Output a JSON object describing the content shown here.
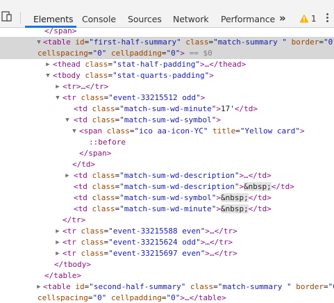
{
  "toolbar": {
    "tabs": [
      {
        "label": "Elements",
        "active": true
      },
      {
        "label": "Console"
      },
      {
        "label": "Sources"
      },
      {
        "label": "Network"
      },
      {
        "label": "Performance"
      }
    ],
    "more_label": "»",
    "warning_count": "1",
    "colors": {
      "active_underline": "#1a73e8",
      "warning": "#f5b400"
    }
  },
  "tree": {
    "l01": "</span>",
    "l02_tag": "<table",
    "l02_a1": "id",
    "l02_v1": "\"first-half-summary\"",
    "l02_a2": "class",
    "l02_v2": "\"match-summary \"",
    "l02_a3": "border",
    "l02_v3": "\"0\"",
    "l03_a1": "cellspacing",
    "l03_v1": "\"0\"",
    "l03_a2": "cellpadding",
    "l03_v2": "\"0\"",
    "l03_tail": ">",
    "l03_eq": " == $0",
    "l04": {
      "open": "<thead",
      "attr": "class",
      "val": "\"stat-half-padding\"",
      "mid": ">…",
      "close": "</thead>"
    },
    "l05": {
      "open": "<tbody",
      "attr": "class",
      "val": "\"stat-quarts-padding\"",
      "mid": ">"
    },
    "l06": {
      "open": "<tr>",
      "mid": "…",
      "close": "</tr>"
    },
    "l07": {
      "open": "<tr",
      "attr": "class",
      "val": "\"event-33215512 odd\"",
      "mid": ">"
    },
    "l08": {
      "open": "<td",
      "attr": "class",
      "val": "\"match-sum-wd-minute\"",
      "mid": ">",
      "text": "17'",
      "close": "</td>"
    },
    "l09": {
      "open": "<td",
      "attr": "class",
      "val": "\"match-sum-wd-symbol\"",
      "mid": ">"
    },
    "l10": {
      "open": "<span",
      "attr": "class",
      "val": "\"ico aa-icon-YC\"",
      "attr2": "title",
      "val2": "\"Yellow card\"",
      "mid": ">"
    },
    "l11": "::before",
    "l12": "</span>",
    "l13": "</td>",
    "l14": {
      "open": "<td",
      "attr": "class",
      "val": "\"match-sum-wd-description\"",
      "mid": ">…",
      "close": "</td>"
    },
    "l15": {
      "open": "<td",
      "attr": "class",
      "val": "\"match-sum-wd-description\"",
      "mid": ">",
      "ent": "&nbsp;",
      "close": "</td>"
    },
    "l16": {
      "open": "<td",
      "attr": "class",
      "val": "\"match-sum-wd-symbol\"",
      "mid": ">",
      "ent": "&nbsp;",
      "close": "</td>"
    },
    "l17": {
      "open": "<td",
      "attr": "class",
      "val": "\"match-sum-wd-minute\"",
      "mid": ">",
      "ent": "&nbsp;",
      "close": "</td>"
    },
    "l18": "</tr>",
    "l19": {
      "open": "<tr",
      "attr": "class",
      "val": "\"event-33215588 even\"",
      "mid": ">…",
      "close": "</tr>"
    },
    "l20": {
      "open": "<tr",
      "attr": "class",
      "val": "\"event-33215624 odd\"",
      "mid": ">…",
      "close": "</tr>"
    },
    "l21": {
      "open": "<tr",
      "attr": "class",
      "val": "\"event-33215697 even\"",
      "mid": ">…",
      "close": "</tr>"
    },
    "l22": "</tbody>",
    "l23": "</table>",
    "l24_tag": "<table",
    "l24_a1": "id",
    "l24_v1": "\"second-half-summary\"",
    "l24_a2": "class",
    "l24_v2": "\"match-summary \"",
    "l24_a3": "border",
    "l24_v3": "\"0\"",
    "l25_a1": "cellspacing",
    "l25_v1": "\"0\"",
    "l25_a2": "cellpadding",
    "l25_v2": "\"0\"",
    "l25_mid": ">…",
    "l25_close": "</table>"
  }
}
